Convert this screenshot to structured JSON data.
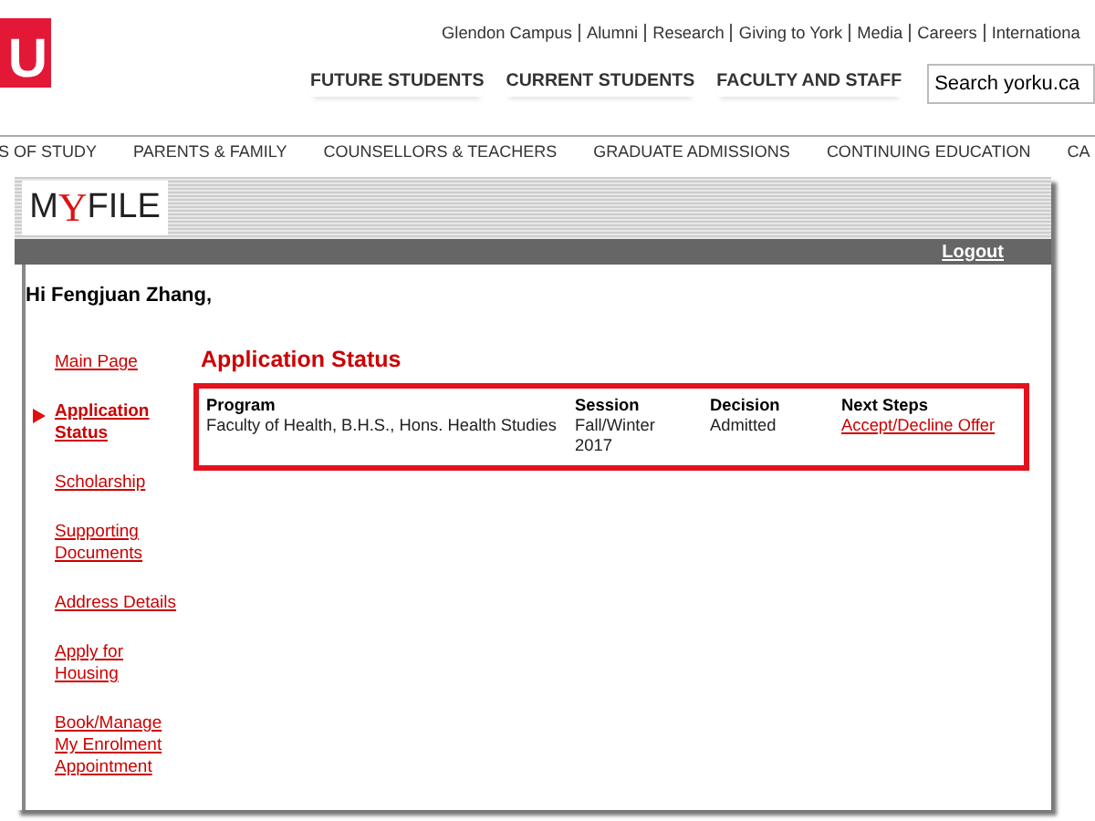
{
  "site_logo": {
    "text": "U"
  },
  "top_links": [
    "Glendon Campus",
    "Alumni",
    "Research",
    "Giving to York",
    "Media",
    "Careers",
    "Internationa"
  ],
  "main_nav": [
    "FUTURE STUDENTS",
    "CURRENT STUDENTS",
    "FACULTY AND STAFF"
  ],
  "search": {
    "value": "Search yorku.ca"
  },
  "secondary_nav": [
    "S OF STUDY",
    "PARENTS & FAMILY",
    "COUNSELLORS & TEACHERS",
    "GRADUATE ADMISSIONS",
    "CONTINUING EDUCATION",
    "CA"
  ],
  "myfile_logo": {
    "before": "M",
    "accent": "Y",
    "after": "FILE"
  },
  "logout": "Logout",
  "greeting": "Hi Fengjuan Zhang,",
  "sidebar": [
    {
      "label": "Main Page",
      "selected": false
    },
    {
      "label": "Application Status",
      "selected": true
    },
    {
      "label": "Scholarship",
      "selected": false
    },
    {
      "label": "Supporting Documents",
      "selected": false
    },
    {
      "label": "Address Details",
      "selected": false
    },
    {
      "label": "Apply for Housing",
      "selected": false
    },
    {
      "label": "Book/Manage My Enrolment Appointment",
      "selected": false
    }
  ],
  "page_title": "Application Status",
  "table": {
    "columns": [
      "Program",
      "Session",
      "Decision",
      "Next Steps"
    ],
    "rows": [
      {
        "program": "Faculty of Health, B.H.S., Hons. Health Studies",
        "session": "Fall/Winter 2017",
        "decision": "Admitted",
        "next_steps": "Accept/Decline Offer"
      }
    ]
  }
}
